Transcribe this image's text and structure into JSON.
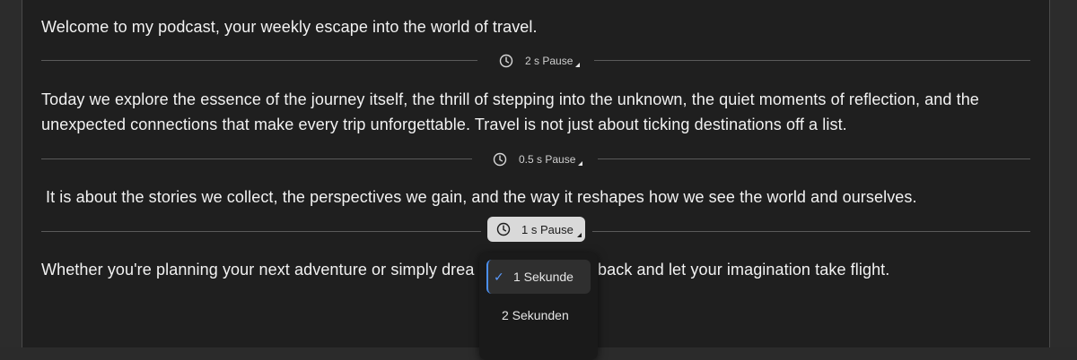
{
  "paragraphs": [
    "Welcome to my podcast, your weekly escape into the world of travel.",
    "Today we explore the essence of the journey itself, the thrill of stepping into the unknown, the quiet moments of reflection, and the unexpected connections that make every trip unforgettable. Travel is not just about ticking destinations off a list.",
    "It is about the stories we collect, the perspectives we gain, and the way it reshapes how we see the world and ourselves.",
    "Whether you're planning your next adventure or simply drea",
    "back and let your imagination take flight."
  ],
  "pauses": [
    {
      "label": "2 s Pause"
    },
    {
      "label": "0.5 s Pause"
    },
    {
      "label": "1 s Pause"
    }
  ],
  "dropdown": {
    "options": [
      {
        "label": "1 Sekunde",
        "selected": true
      },
      {
        "label": "2 Sekunden",
        "selected": false
      }
    ]
  }
}
